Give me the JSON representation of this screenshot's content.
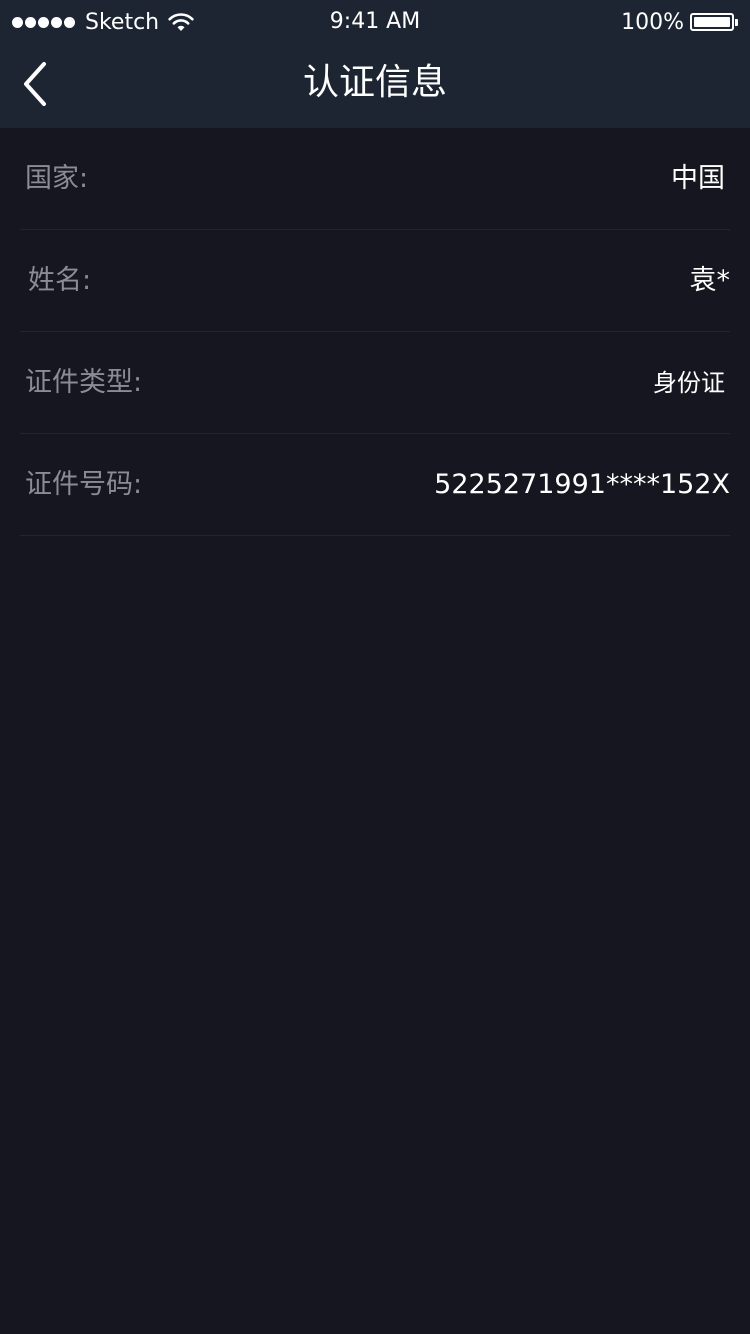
{
  "status_bar": {
    "carrier": "Sketch",
    "time": "9:41 AM",
    "battery": "100%",
    "battery_level": 1.0,
    "signal_bars": 5
  },
  "nav": {
    "back_icon": "chevron-left-icon",
    "title": "认证信息"
  },
  "info": {
    "rows": [
      {
        "label": "国家:",
        "value": "中国"
      },
      {
        "label": "姓名:",
        "value": "袁*"
      },
      {
        "label": "证件类型:",
        "value": "身份证"
      },
      {
        "label": "证件号码:",
        "value": "5225271991****152X"
      }
    ]
  },
  "colors": {
    "background": "#15161f",
    "header": "#1d2533",
    "label": "#8a8c95",
    "value": "#ffffff",
    "divider": "#22242e"
  }
}
